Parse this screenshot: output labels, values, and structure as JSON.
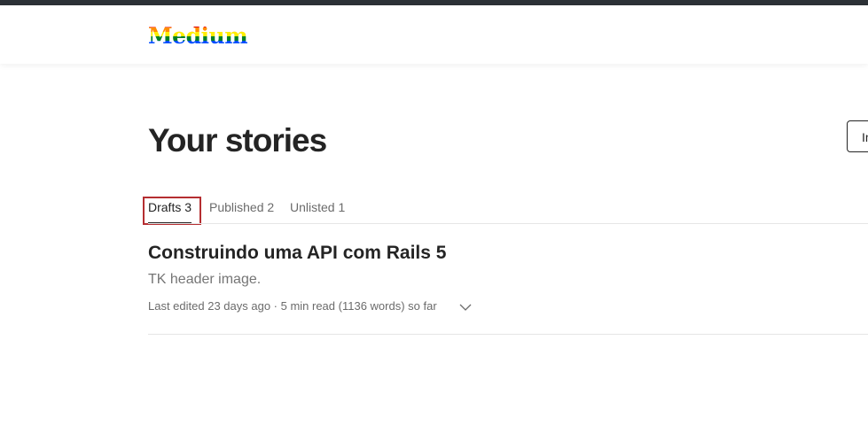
{
  "header": {
    "logo_text": "Medium"
  },
  "main": {
    "page_title": "Your stories",
    "import_button_label": "Import a story",
    "tabs": [
      {
        "label": "Drafts 3",
        "active": true
      },
      {
        "label": "Published 2",
        "active": false
      },
      {
        "label": "Unlisted 1",
        "active": false
      }
    ],
    "stories": [
      {
        "title": "Construindo uma API com Rails 5",
        "subtitle": "TK header image.",
        "meta": "Last edited 23 days ago · 5 min read (1136 words) so far",
        "menu_icon": "chevron-down-icon"
      }
    ]
  },
  "colors": {
    "text_primary": "#242424",
    "text_secondary": "#6b6b6b",
    "highlight": "#b52e31",
    "top_strip": "#2c3136"
  }
}
